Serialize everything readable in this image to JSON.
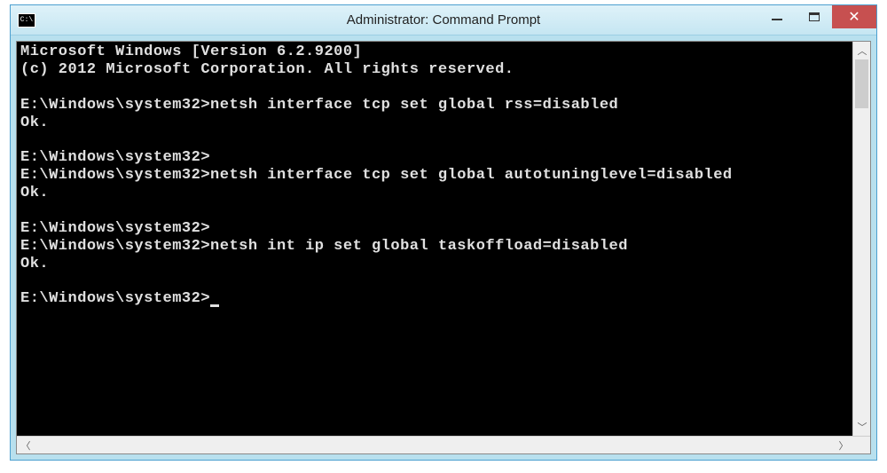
{
  "window": {
    "title": "Administrator: Command Prompt",
    "icon_label": "C:\\"
  },
  "console": {
    "header_line1": "Microsoft Windows [Version 6.2.9200]",
    "header_line2": "(c) 2012 Microsoft Corporation. All rights reserved.",
    "blocks": [
      {
        "prompt": "E:\\Windows\\system32>",
        "command": "netsh interface tcp set global rss=disabled",
        "output": "Ok."
      },
      {
        "prompt": "E:\\Windows\\system32>",
        "command": "",
        "output": ""
      },
      {
        "prompt": "E:\\Windows\\system32>",
        "command": "netsh interface tcp set global autotuninglevel=disabled",
        "output": "Ok."
      },
      {
        "prompt": "E:\\Windows\\system32>",
        "command": "",
        "output": ""
      },
      {
        "prompt": "E:\\Windows\\system32>",
        "command": "netsh int ip set global taskoffload=disabled",
        "output": "Ok."
      }
    ],
    "current_prompt": "E:\\Windows\\system32>"
  }
}
